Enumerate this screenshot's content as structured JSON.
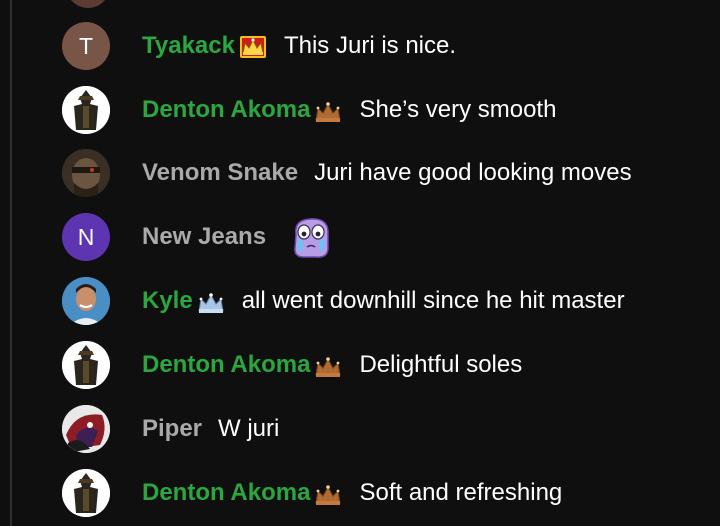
{
  "chat": {
    "messages": [
      {
        "avatar_letter": "T",
        "author": "Tyakack",
        "badge": "gold-crown-icon",
        "text": "This Juri is nice."
      },
      {
        "avatar_letter": "",
        "author": "Denton Akoma",
        "badge": "bronze-crown-icon",
        "text": "She’s very smooth"
      },
      {
        "avatar_letter": "",
        "author": "Venom Snake",
        "badge": "",
        "text": "Juri have good looking moves"
      },
      {
        "avatar_letter": "N",
        "author": "New Jeans",
        "badge": "",
        "text": "",
        "emoji": "crying-face-emoji"
      },
      {
        "avatar_letter": "",
        "author": "Kyle",
        "badge": "silver-crown-icon",
        "text": "all went downhill since he hit master"
      },
      {
        "avatar_letter": "",
        "author": "Denton Akoma",
        "badge": "bronze-crown-icon",
        "text": "Delightful soles"
      },
      {
        "avatar_letter": "",
        "author": "Piper",
        "badge": "",
        "text": "W juri"
      },
      {
        "avatar_letter": "",
        "author": "Denton Akoma",
        "badge": "bronze-crown-icon",
        "text": "Soft and refreshing"
      }
    ]
  },
  "colors": {
    "background": "#0f0f0f",
    "member_name": "#2ba640",
    "plain_name": "#aaaaaa",
    "message_text": "#ffffff",
    "avatar_brown": "#795548",
    "avatar_purple": "#5e35b1"
  }
}
